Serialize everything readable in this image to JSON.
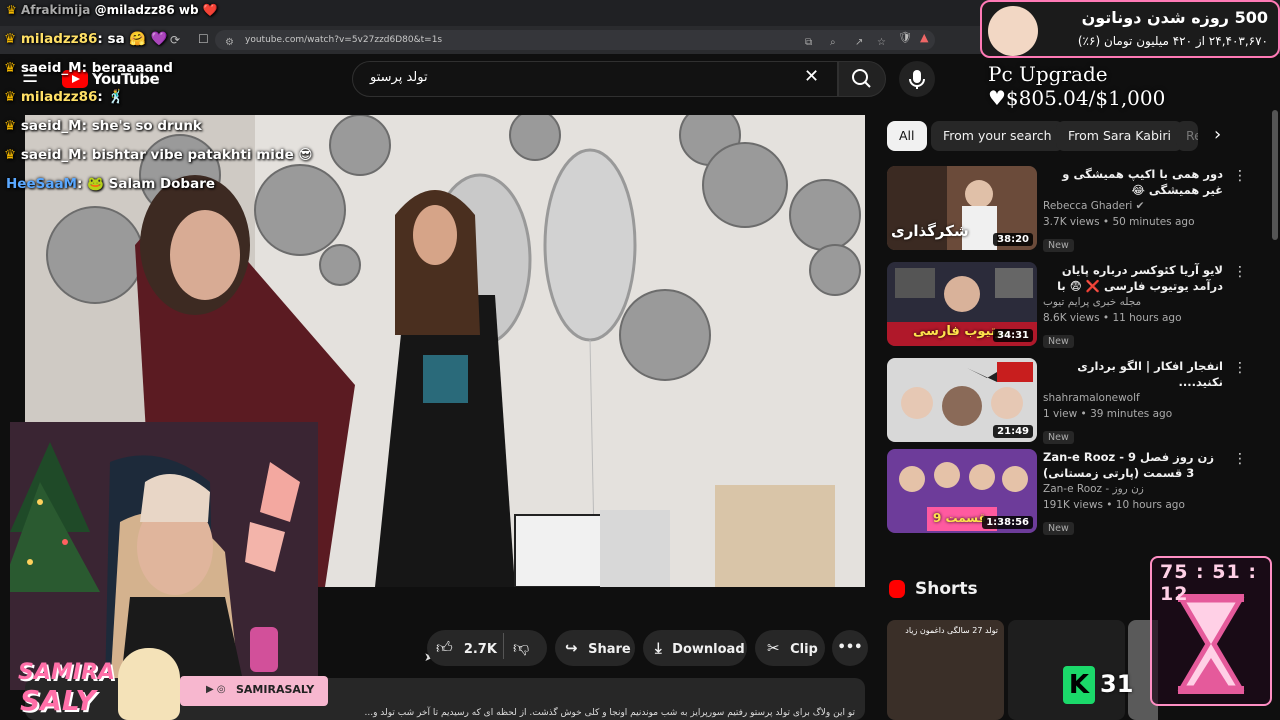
{
  "browser": {
    "url": "youtube.com/watch?v=5v27zzd6D80&t=1s"
  },
  "youtube": {
    "logo_text": "YouTube",
    "search_query": "تولد پرستو",
    "chips": [
      "All",
      "From your search",
      "From Sara Kabiri",
      "Re"
    ],
    "actions": {
      "like_count": "2.7K",
      "share": "Share",
      "download": "Download",
      "clip": "Clip"
    },
    "description": "تو این ولاگ برای تولد پرستو رفتیم سورپرایز به شب موندنیم اونجا و کلی خوش گذشت. از لحظه ای که رسیدیم تا آخر شب تولد و...",
    "shorts_heading": "Shorts",
    "recommended": [
      {
        "title": "دور همی با اکیپ همیشگی و غیر همیشگی 😂",
        "channel": "Rebecca Ghaderi",
        "meta": "3.7K views • 50 minutes ago",
        "badge": "New",
        "duration": "38:20",
        "thumb_text": "شکرگذاری"
      },
      {
        "title": "لایو آریا کئوکسر درباره پایان درآمد یوتیوب فارسی ❌ 😨 با میا و کوروش هم صحبت",
        "channel": "مجله خبری پرایم تیوب",
        "meta": "8.6K views • 11 hours ago",
        "badge": "New",
        "duration": "34:31",
        "thumb_text": "یوتیوب فارسی"
      },
      {
        "title": "انفجار افکار | الگو برداری نکنید....",
        "channel": "shahramalonewolf",
        "meta": "1 view • 39 minutes ago",
        "badge": "New",
        "duration": "21:49",
        "thumb_text": ""
      },
      {
        "title": "Zan-e Rooz - 9 زن روز فصل 3 قسمت (پارتی زمستانی)",
        "channel": "Zan-e Rooz - زن روز",
        "meta": "191K views • 10 hours ago",
        "badge": "New",
        "duration": "1:38:56",
        "thumb_text": "قسمت 9"
      }
    ],
    "shorts_thumb_text": "تولد 27 سالگی داغمون زیاد"
  },
  "chat": [
    {
      "user": "Afrakimija",
      "msg": "@miladzz86 wb ❤️",
      "color": "#ffffff"
    },
    {
      "user": "miladzz86",
      "msg": "sa 🤗 💜",
      "color": "#ffe066"
    },
    {
      "user": "saeid_M",
      "msg": "beraaaand",
      "color": "#ffffff"
    },
    {
      "user": "miladzz86",
      "msg": "🕺",
      "color": "#ffe066"
    },
    {
      "user": "saeid_M",
      "msg": "she's so drunk",
      "color": "#ffffff"
    },
    {
      "user": "saeid_M",
      "msg": "bishtar vibe patakhti mide 😎",
      "color": "#ffffff"
    },
    {
      "user": "HeeSaaM",
      "msg": "🐸 Salam Dobare",
      "color": "#5aa8ff"
    }
  ],
  "overlay": {
    "donation_title": "500 روزه شدن دوناتون",
    "donation_sub": "۲۴,۴۰۳,۶۷۰ از ۴۲۰ میلیون تومان (۶٪)",
    "pc_goal": "Pc Upgrade ♥$805.04/$1,000",
    "timer": "75 : 51 : 12",
    "brand_name_1": "SAMIRA",
    "brand_name_2": "SALY",
    "social_handle": "SAMIRASALY",
    "shorts_count": "31"
  },
  "colors": {
    "yt_red": "#ff0000",
    "overlay_pink": "#ff7ab6",
    "crown": "#f5b800"
  }
}
